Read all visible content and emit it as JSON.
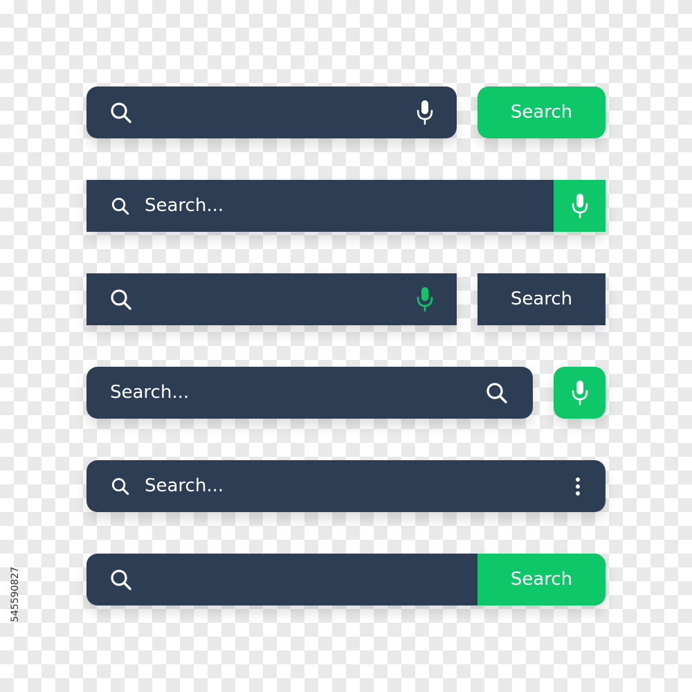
{
  "colors": {
    "bar": "#2d3e54",
    "accent": "#0dc768",
    "text": "#ffffff"
  },
  "bars": [
    {
      "variant": "rounded-with-mic-and-button",
      "button_label": "Search",
      "icons": [
        "search-icon",
        "mic-icon"
      ]
    },
    {
      "variant": "square-with-mic-block",
      "placeholder": "Search...",
      "icons": [
        "search-icon",
        "mic-icon"
      ]
    },
    {
      "variant": "square-with-green-mic-and-button",
      "button_label": "Search",
      "icons": [
        "search-icon",
        "mic-icon"
      ]
    },
    {
      "variant": "rounded-search-right-mic-button",
      "placeholder": "Search...",
      "icons": [
        "search-icon",
        "mic-icon"
      ]
    },
    {
      "variant": "rounded-with-more-menu",
      "placeholder": "Search...",
      "icons": [
        "search-icon",
        "more-vertical-icon"
      ]
    },
    {
      "variant": "rounded-attached-button",
      "button_label": "Search",
      "icons": [
        "search-icon"
      ]
    }
  ],
  "stock_id": "545590827"
}
